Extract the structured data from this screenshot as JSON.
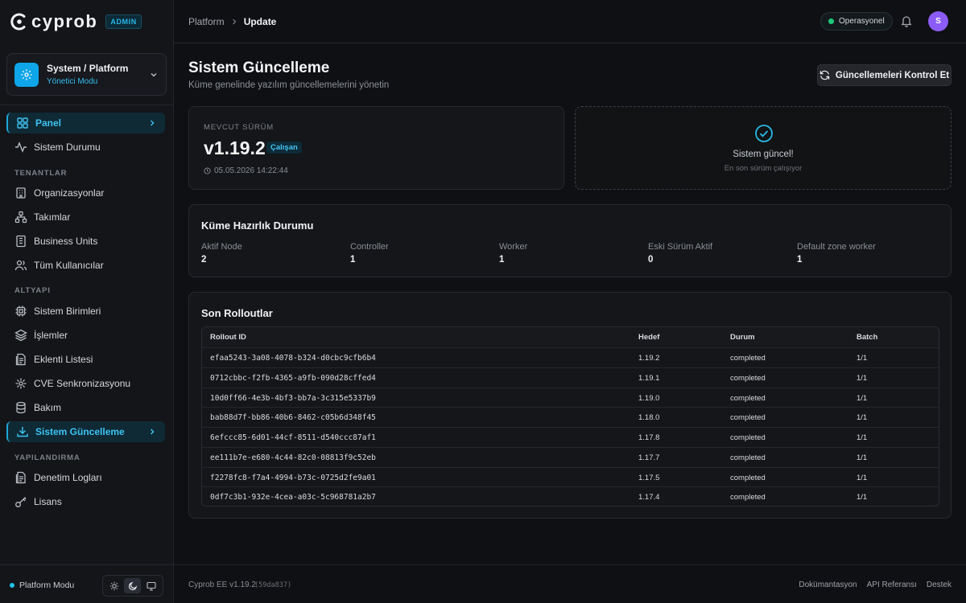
{
  "brand": {
    "name": "cyprob",
    "badge": "ADMIN"
  },
  "context": {
    "title": "System / Platform",
    "subtitle": "Yönetici Modu"
  },
  "sidebar": {
    "top_items": [
      {
        "label": "Panel",
        "icon": "dashboard-icon",
        "active": true
      },
      {
        "label": "Sistem Durumu",
        "icon": "activity-icon"
      }
    ],
    "sections": [
      {
        "label": "TENANTLAR",
        "items": [
          {
            "label": "Organizasyonlar",
            "icon": "building-icon"
          },
          {
            "label": "Takımlar",
            "icon": "team-icon"
          },
          {
            "label": "Business Units",
            "icon": "office-icon"
          },
          {
            "label": "Tüm Kullanıcılar",
            "icon": "users-icon"
          }
        ]
      },
      {
        "label": "ALTYAPI",
        "items": [
          {
            "label": "Sistem Birimleri",
            "icon": "chip-icon"
          },
          {
            "label": "İşlemler",
            "icon": "layers-icon"
          },
          {
            "label": "Eklenti Listesi",
            "icon": "list-icon"
          },
          {
            "label": "CVE Senkronizasyonu",
            "icon": "cve-icon"
          },
          {
            "label": "Bakım",
            "icon": "database-icon"
          },
          {
            "label": "Sistem Güncelleme",
            "icon": "download-icon",
            "active": true
          }
        ]
      },
      {
        "label": "YAPILANDIRMA",
        "items": [
          {
            "label": "Denetim Logları",
            "icon": "log-icon"
          },
          {
            "label": "Lisans",
            "icon": "key-icon"
          }
        ]
      }
    ],
    "footer": {
      "mode_label": "Platform Modu",
      "theme": "dark"
    }
  },
  "header": {
    "breadcrumb": {
      "parent": "Platform",
      "current": "Update"
    },
    "status": "Operasyonel",
    "avatar_initial": "S"
  },
  "main": {
    "title": "Sistem Güncelleme",
    "subtitle": "Küme genelinde yazılım güncellemelerini yönetin",
    "check_button": "Güncellemeleri Kontrol Et",
    "current": {
      "label": "MEVCUT SÜRÜM",
      "version": "v1.19.2",
      "badge": "Çalışan",
      "date": "05.05.2026 14:22:44"
    },
    "up_to_date": {
      "title": "Sistem güncel!",
      "subtitle": "En son sürüm çalışıyor"
    },
    "readiness": {
      "title": "Küme Hazırlık Durumu",
      "stats": [
        {
          "label": "Aktif Node",
          "value": "2"
        },
        {
          "label": "Controller",
          "value": "1"
        },
        {
          "label": "Worker",
          "value": "1"
        },
        {
          "label": "Eski Sürüm Aktif",
          "value": "0"
        },
        {
          "label": "Default zone worker",
          "value": "1"
        }
      ]
    },
    "rollouts": {
      "title": "Son Rolloutlar",
      "columns": [
        "Rollout ID",
        "Hedef",
        "Durum",
        "Batch"
      ],
      "rows": [
        [
          "efaa5243-3a08-4078-b324-d0cbc9cfb6b4",
          "1.19.2",
          "completed",
          "1/1"
        ],
        [
          "0712cbbc-f2fb-4365-a9fb-090d28cffed4",
          "1.19.1",
          "completed",
          "1/1"
        ],
        [
          "10d0ff66-4e3b-4bf3-bb7a-3c315e5337b9",
          "1.19.0",
          "completed",
          "1/1"
        ],
        [
          "bab88d7f-bb86-40b6-8462-c05b6d348f45",
          "1.18.0",
          "completed",
          "1/1"
        ],
        [
          "6efccc85-6d01-44cf-8511-d540ccc87af1",
          "1.17.8",
          "completed",
          "1/1"
        ],
        [
          "ee111b7e-e680-4c44-82c0-08813f9c52eb",
          "1.17.7",
          "completed",
          "1/1"
        ],
        [
          "f2278fc8-f7a4-4994-b73c-0725d2fe9a01",
          "1.17.5",
          "completed",
          "1/1"
        ],
        [
          "0df7c3b1-932e-4cea-a03c-5c968781a2b7",
          "1.17.4",
          "completed",
          "1/1"
        ]
      ]
    }
  },
  "footer": {
    "version": "Cyprob EE v1.19.2",
    "hash": "(59da837)",
    "links": [
      "Dokümantasyon",
      "API Referansı",
      "Destek"
    ]
  },
  "colors": {
    "accent": "#1ea7d8",
    "status_ok": "#1fc97a",
    "avatar": "#8b5cf6"
  }
}
